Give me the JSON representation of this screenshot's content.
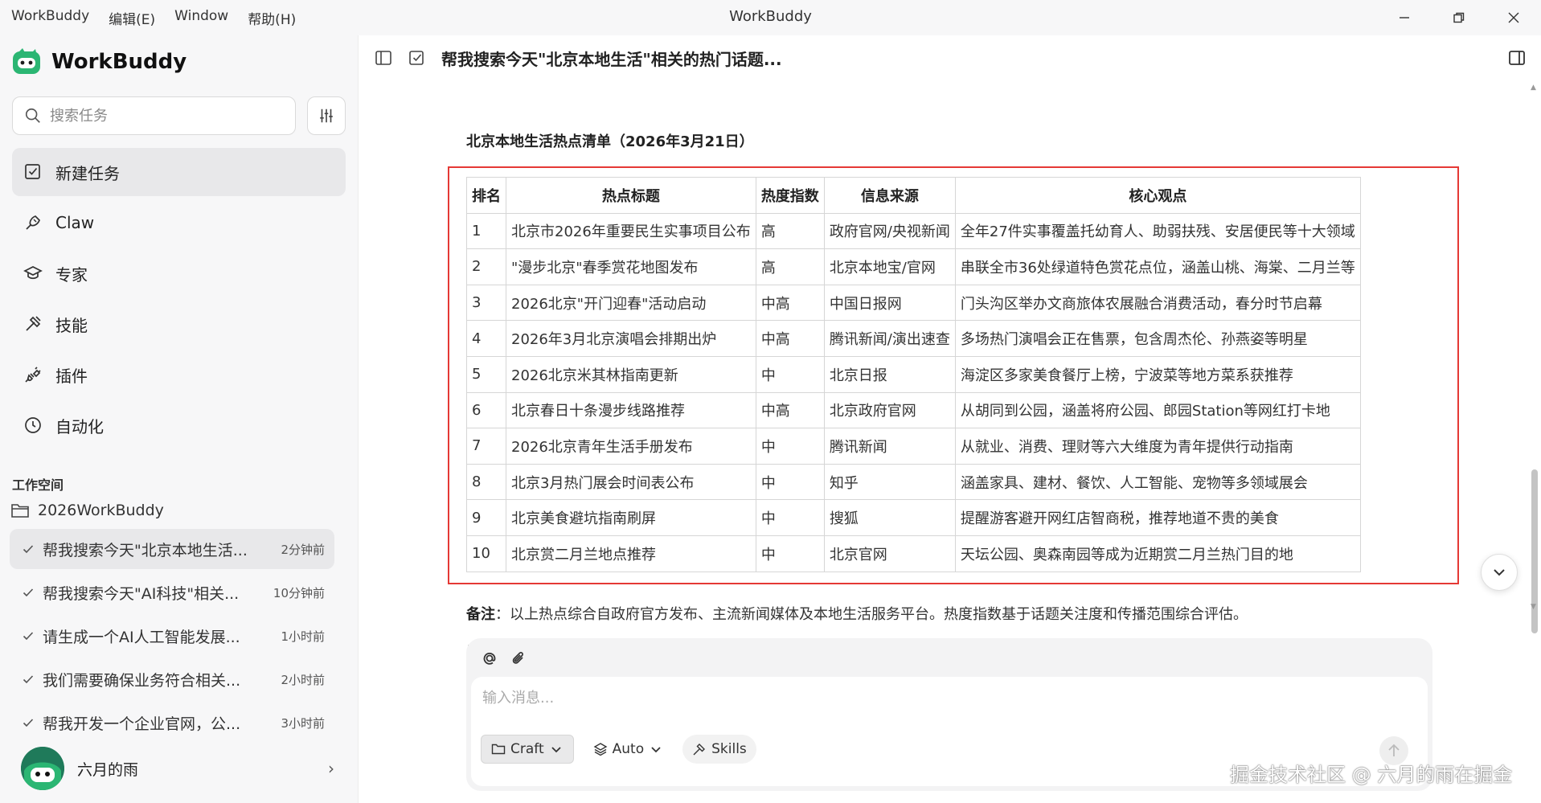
{
  "window": {
    "menu": [
      "WorkBuddy",
      "编辑(E)",
      "Window",
      "帮助(H)"
    ],
    "title": "WorkBuddy"
  },
  "sidebar": {
    "brand": "WorkBuddy",
    "search_placeholder": "搜索任务",
    "nav": [
      {
        "label": "新建任务",
        "icon": "new-task-icon"
      },
      {
        "label": "Claw",
        "icon": "claw-icon"
      },
      {
        "label": "专家",
        "icon": "expert-icon"
      },
      {
        "label": "技能",
        "icon": "skill-icon"
      },
      {
        "label": "插件",
        "icon": "plugin-icon"
      },
      {
        "label": "自动化",
        "icon": "clock-icon"
      }
    ],
    "workspace_label": "工作空间",
    "workspace_folder": "2026WorkBuddy",
    "tasks": [
      {
        "title": "帮我搜索今天\"北京本地生活...",
        "time": "2分钟前"
      },
      {
        "title": "帮我搜索今天\"AI科技\"相关...",
        "time": "10分钟前"
      },
      {
        "title": "请生成一个AI人工智能发展...",
        "time": "1小时前"
      },
      {
        "title": "我们需要确保业务符合相关...",
        "time": "2小时前"
      },
      {
        "title": "帮我开发一个企业官网，公...",
        "time": "3小时前"
      }
    ],
    "user_name": "六月的雨"
  },
  "main": {
    "conversation_title": "帮我搜索今天\"北京本地生活\"相关的热门话题...",
    "list_heading": "北京本地生活热点清单（2026年3月21日）",
    "table": {
      "headers": [
        "排名",
        "热点标题",
        "热度指数",
        "信息来源",
        "核心观点"
      ],
      "rows": [
        [
          "1",
          "北京市2026年重要民生实事项目公布",
          "高",
          "政府官网/央视新闻",
          "全年27件实事覆盖托幼育人、助弱扶残、安居便民等十大领域"
        ],
        [
          "2",
          "\"漫步北京\"春季赏花地图发布",
          "高",
          "北京本地宝/官网",
          "串联全市36处绿道特色赏花点位，涵盖山桃、海棠、二月兰等"
        ],
        [
          "3",
          "2026北京\"开门迎春\"活动启动",
          "中高",
          "中国日报网",
          "门头沟区举办文商旅体农展融合消费活动，春分时节启幕"
        ],
        [
          "4",
          "2026年3月北京演唱会排期出炉",
          "中高",
          "腾讯新闻/演出速查",
          "多场热门演唱会正在售票，包含周杰伦、孙燕姿等明星"
        ],
        [
          "5",
          "2026北京米其林指南更新",
          "中",
          "北京日报",
          "海淀区多家美食餐厅上榜，宁波菜等地方菜系获推荐"
        ],
        [
          "6",
          "北京春日十条漫步线路推荐",
          "中高",
          "北京政府官网",
          "从胡同到公园，涵盖将府公园、郎园Station等网红打卡地"
        ],
        [
          "7",
          "2026北京青年生活手册发布",
          "中",
          "腾讯新闻",
          "从就业、消费、理财等六大维度为青年提供行动指南"
        ],
        [
          "8",
          "北京3月热门展会时间表公布",
          "中",
          "知乎",
          "涵盖家具、建材、餐饮、人工智能、宠物等多领域展会"
        ],
        [
          "9",
          "北京美食避坑指南刷屏",
          "中",
          "搜狐",
          "提醒游客避开网红店智商税，推荐地道不贵的美食"
        ],
        [
          "10",
          "北京赏二月兰地点推荐",
          "中",
          "北京官网",
          "天坛公园、奥森南园等成为近期赏二月兰热门目的地"
        ]
      ]
    },
    "note_label": "备注",
    "note_text": "：以上热点综合自政府官方发布、主流新闻媒体及本地生活服务平台。热度指数基于话题关注度和传播范围综合评估。",
    "composer": {
      "placeholder": "输入消息...",
      "mode": "Craft",
      "model": "Auto",
      "skills": "Skills"
    }
  },
  "watermark": "掘金技术社区 @ 六月的雨在掘金",
  "colors": {
    "highlight_border": "#e53935",
    "brand_green": "#2bb673"
  }
}
